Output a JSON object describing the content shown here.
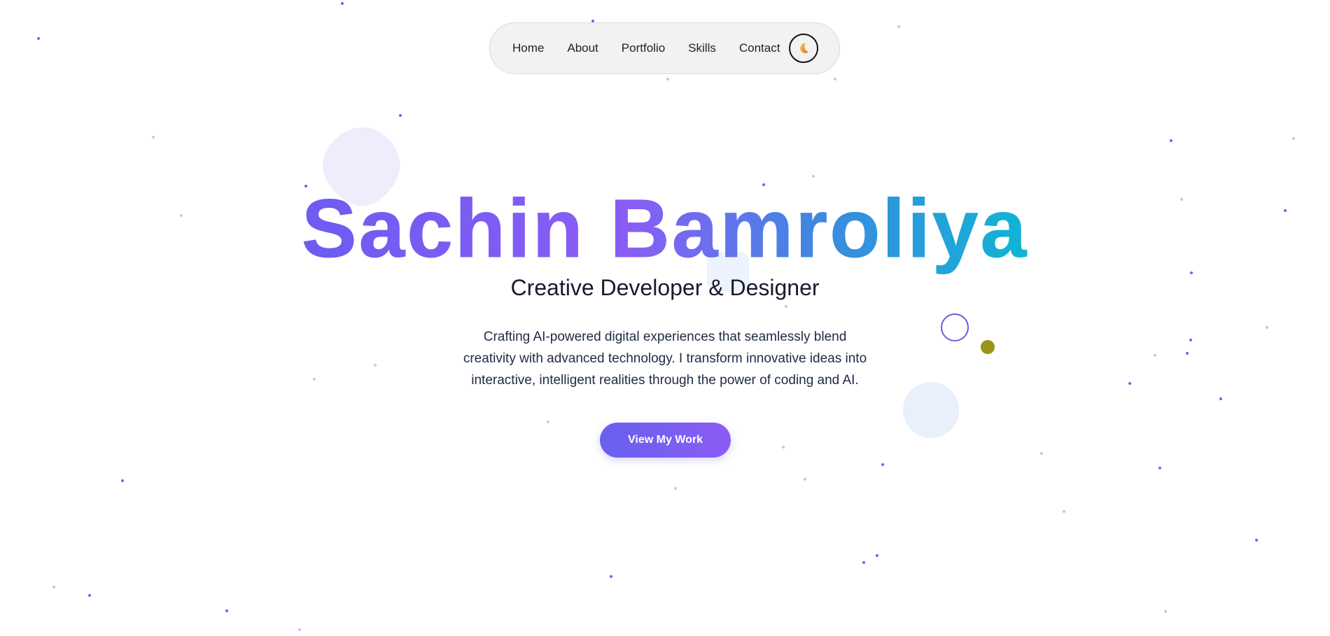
{
  "nav": {
    "links": [
      "Home",
      "About",
      "Portfolio",
      "Skills",
      "Contact"
    ],
    "theme_toggle_icon": "moon-icon"
  },
  "hero": {
    "name": "Sachin Bamroliya",
    "subtitle": "Creative Developer & Designer",
    "description": "Crafting AI-powered digital experiences that seamlessly blend creativity with advanced technology. I transform innovative ideas into interactive, intelligent realities through the power of coding and AI.",
    "cta_label": "View My Work"
  },
  "colors": {
    "accent": "#8b5cf6",
    "gradient_start": "#6d5cf0",
    "gradient_end": "#0fb5d4"
  }
}
